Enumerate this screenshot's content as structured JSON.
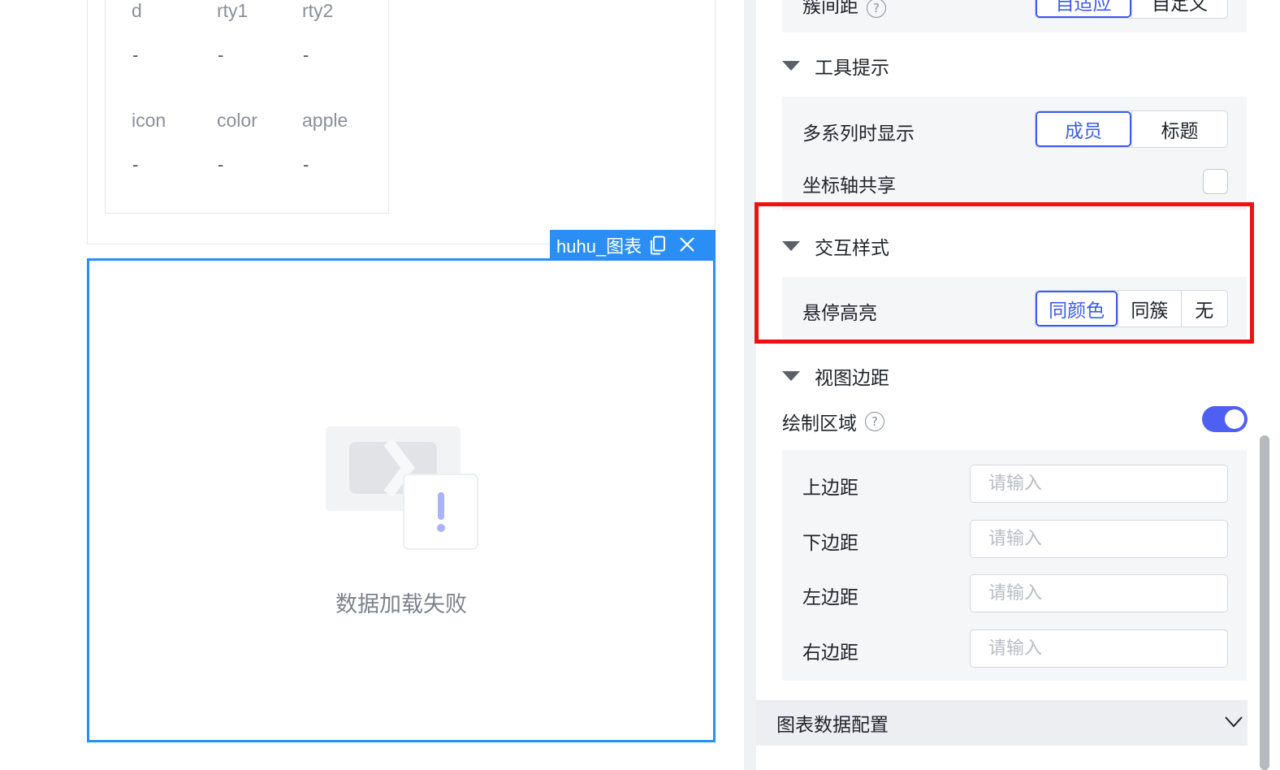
{
  "table": {
    "header_row1": [
      "d",
      "rty1",
      "rty2"
    ],
    "values_row1": [
      "-",
      "-",
      "-"
    ],
    "header_row2": [
      "icon",
      "color",
      "apple"
    ],
    "values_row2": [
      "-",
      "-",
      "-"
    ]
  },
  "chart_component": {
    "tag_title": "huhu_图表",
    "empty_message": "数据加载失败"
  },
  "panel": {
    "top_partial": {
      "label": "簇间距",
      "options": [
        "自适应",
        "自定义"
      ],
      "selected": "自适应"
    },
    "tooltip_section": {
      "title": "工具提示",
      "multi_series_label": "多系列时显示",
      "multi_series_options": [
        "成员",
        "标题"
      ],
      "multi_series_selected": "成员",
      "axis_share_label": "坐标轴共享",
      "axis_share_checked": false
    },
    "interaction_section": {
      "title": "交互样式",
      "hover_label": "悬停高亮",
      "hover_options": [
        "同颜色",
        "同簇",
        "无"
      ],
      "hover_selected": "同颜色"
    },
    "view_margin_section": {
      "title": "视图边距",
      "draw_area_label": "绘制区域",
      "draw_area_enabled": true,
      "fields": [
        {
          "label": "上边距",
          "placeholder": "请输入",
          "value": ""
        },
        {
          "label": "下边距",
          "placeholder": "请输入",
          "value": ""
        },
        {
          "label": "左边距",
          "placeholder": "请输入",
          "value": ""
        },
        {
          "label": "右边距",
          "placeholder": "请输入",
          "value": ""
        }
      ]
    },
    "footer_section_title": "图表数据配置"
  },
  "colors": {
    "accent": "#3b5bf0",
    "selection_border": "#2a8ef4",
    "highlight_box": "#ee1111",
    "toggle_on": "#4e5ff4"
  },
  "icons": [
    "copy-icon",
    "close-icon",
    "help-icon",
    "caret-down-icon",
    "chevron-down-icon",
    "data-load-failed-illustration"
  ]
}
